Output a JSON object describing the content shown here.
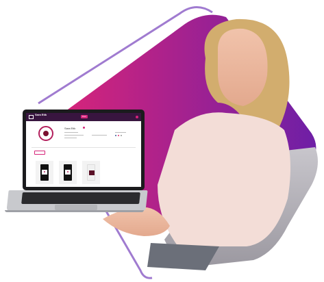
{
  "decor_colors": {
    "gradient_start": "#d6247a",
    "gradient_end": "#6e1fa6",
    "outline": "#a07bd0"
  },
  "laptop_screen": {
    "brand": "Sara Etik",
    "store_name": "Sara Etik",
    "follow_label": "Follow",
    "nav_active": "Dom",
    "accent_color": "#d6247a",
    "header_color": "#38153f"
  }
}
